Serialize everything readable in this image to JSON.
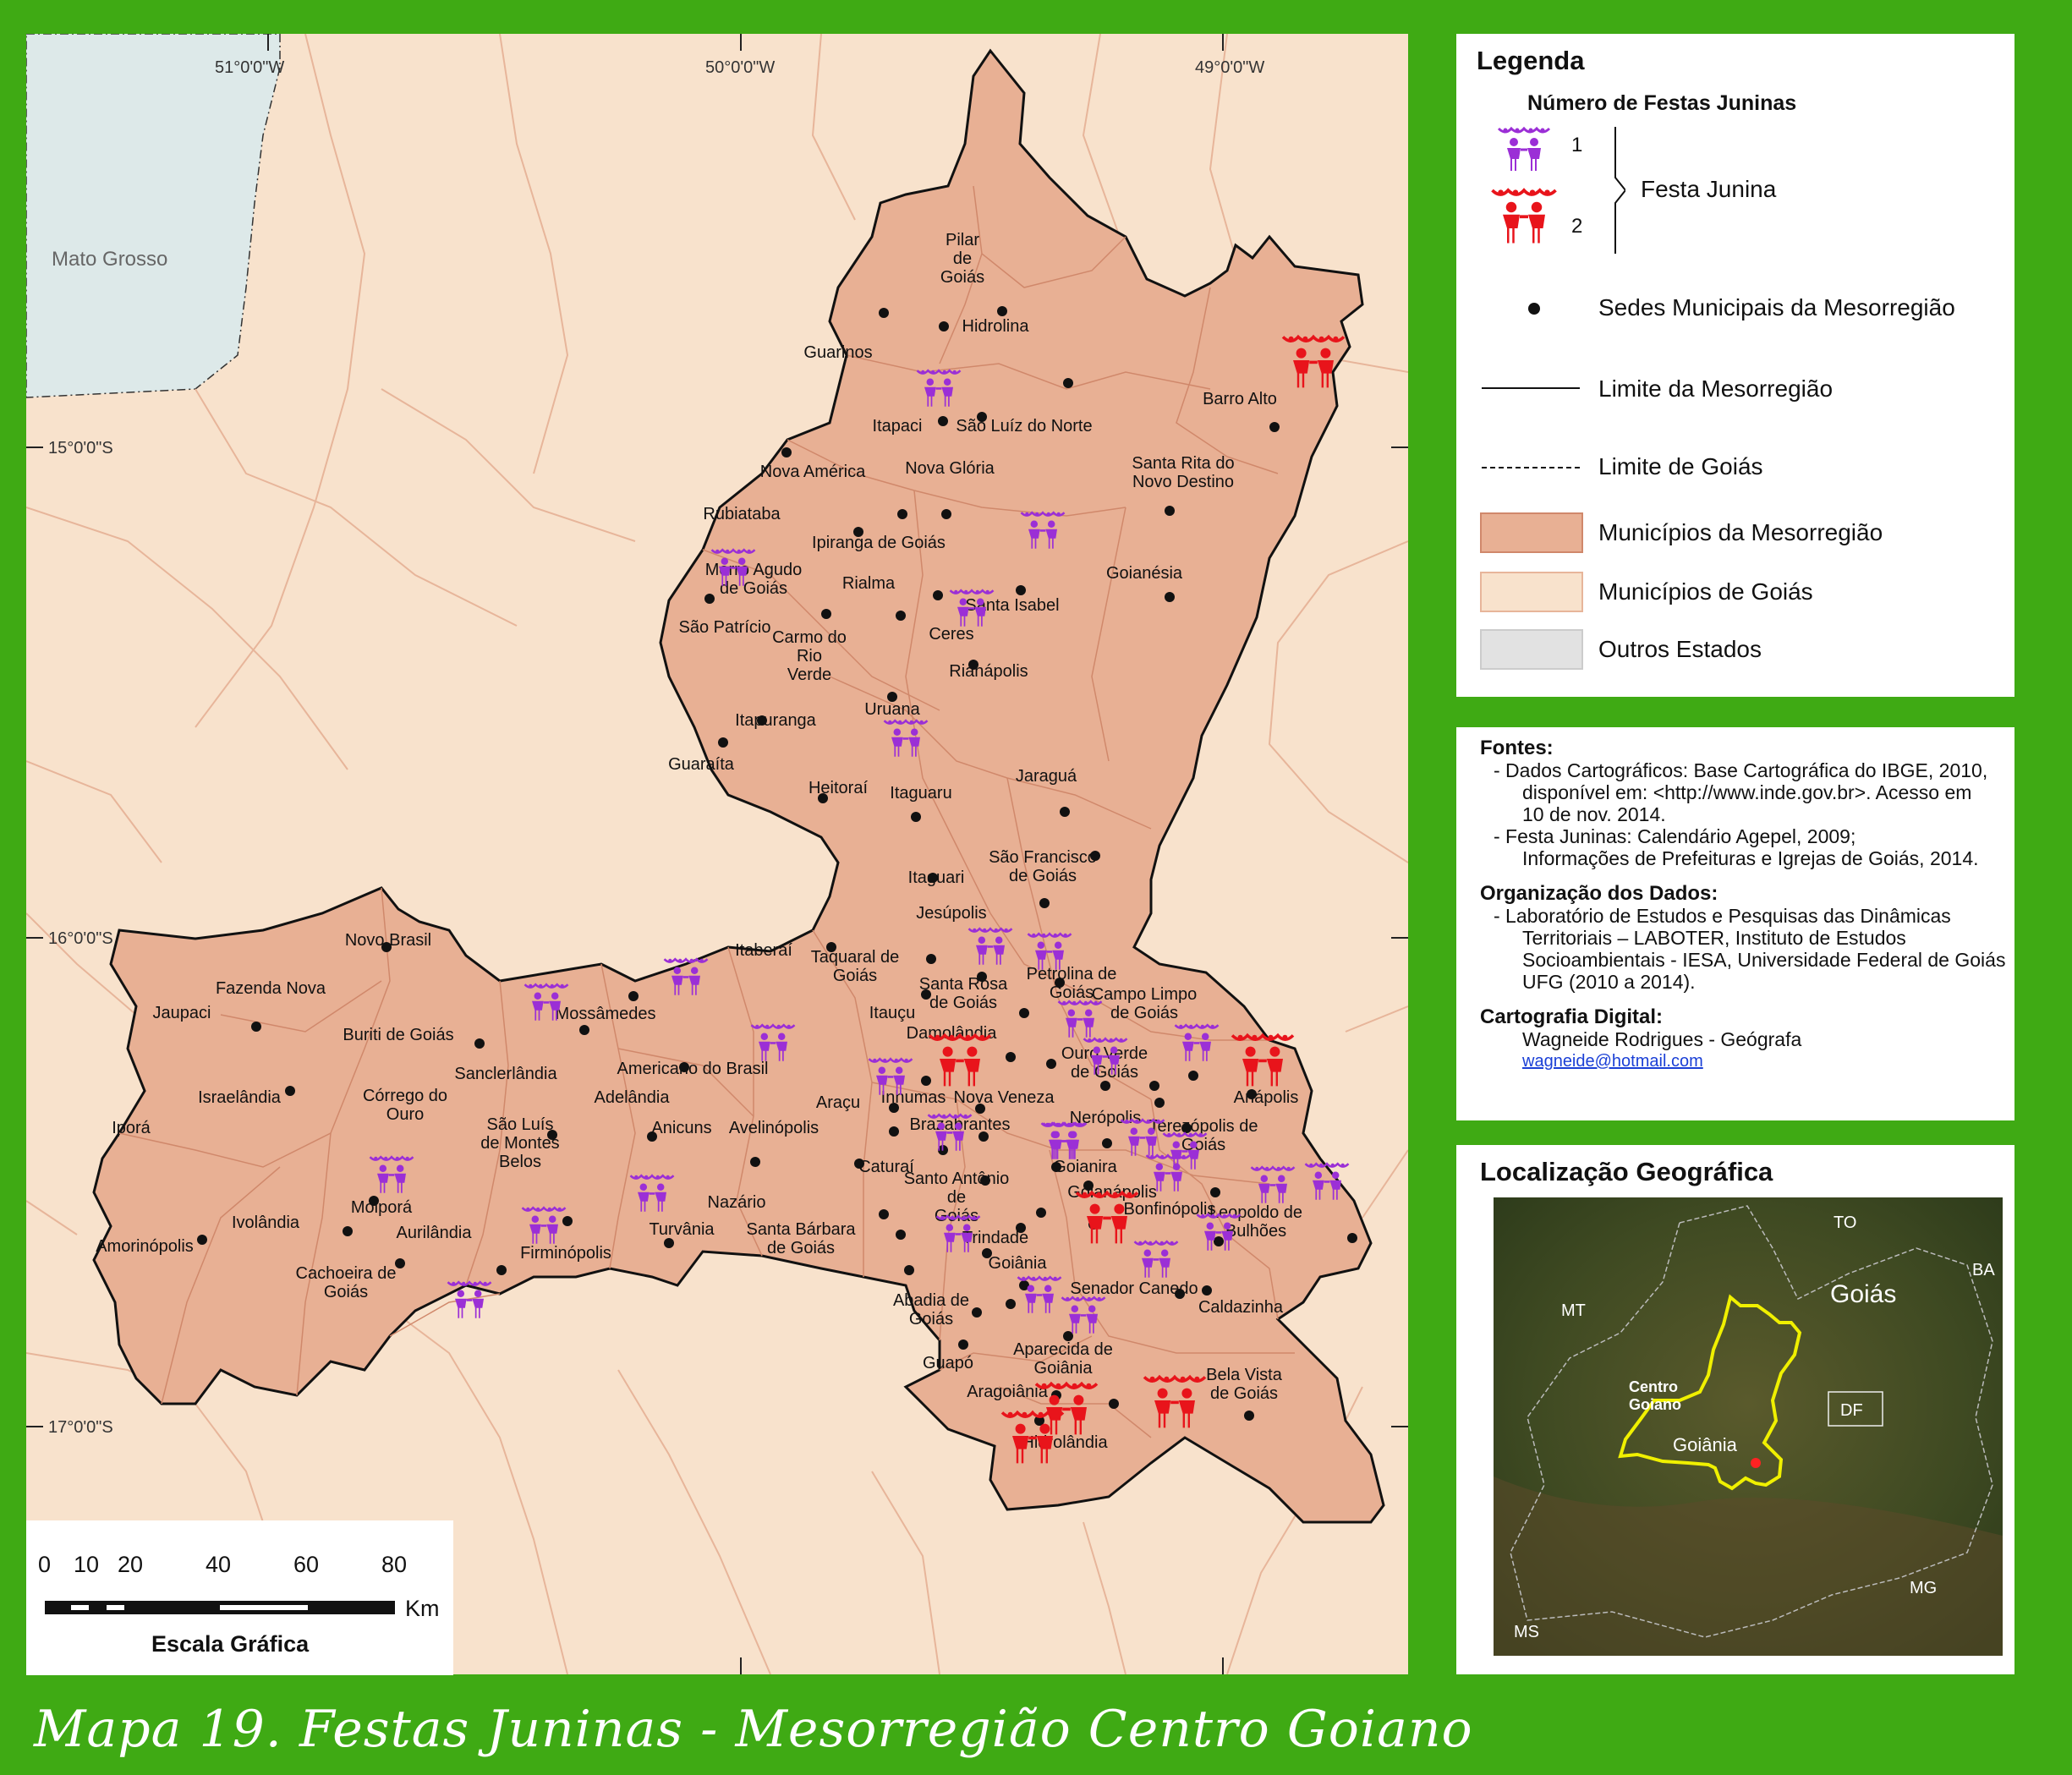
{
  "title": "Mapa 19. Festas Juninas - Mesorregião Centro Goiano",
  "map": {
    "coords": {
      "lon51": "51°0'0\"W",
      "lon50": "50°0'0\"W",
      "lon49": "49°0'0\"W",
      "lat15": "15°0'0\"S",
      "lat16": "16°0'0\"S",
      "lat17": "17°0'0\"S"
    },
    "neighbor_state": "Mato Grosso",
    "cities": [
      "Pilar de Goiás",
      "Hidrolina",
      "Guarinos",
      "Barro Alto",
      "Itapaci",
      "São Luíz do Norte",
      "Nova América",
      "Nova Glória",
      "Santa Rita do Novo Destino",
      "Rubiataba",
      "Ipiranga de Goiás",
      "Morro Agudo de Goiás",
      "Rialma",
      "Goianésia",
      "São Patrício",
      "Santa Isabel",
      "Carmo do Rio Verde",
      "Ceres",
      "Rianápolis",
      "Uruana",
      "Itapuranga",
      "Guaraíta",
      "Jaraguá",
      "Heitoraí",
      "Itaguaru",
      "São Francisco de Goiás",
      "Itaguari",
      "Jesúpolis",
      "Novo Brasil",
      "Itaberaí",
      "Taquaral de Goiás",
      "Fazenda Nova",
      "Santa Rosa de Goiás",
      "Petrolina de Goiás",
      "Campo Limpo de Goiás",
      "Jaupaci",
      "Mossâmedes",
      "Itauçu",
      "Buriti de Goiás",
      "Damolândia",
      "Ouro Verde de Goiás",
      "Sanclerlândia",
      "Americano do Brasil",
      "Anápolis",
      "Israelândia",
      "Córrego do Ouro",
      "Adelândia",
      "Inhumas",
      "Nova Veneza",
      "Araçu",
      "Nerópolis",
      "Iporá",
      "São Luís de Montes Belos",
      "Anicuns",
      "Avelinópolis",
      "Brazabrantes",
      "Terezópolis de Goiás",
      "Caturaí",
      "Goianira",
      "Moiporá",
      "Santo Antônio de Goiás",
      "Goianápolis",
      "Bonfinópolis",
      "Nazário",
      "Ivolândia",
      "Aurilândia",
      "Turvânia",
      "Leopoldo de Bulhões",
      "Amorinópolis",
      "Santa Bárbara de Goiás",
      "Trindade",
      "Firminópolis",
      "Goiânia",
      "Cachoeira de Goiás",
      "Senador Canedo",
      "Abadia de Goiás",
      "Caldazinha",
      "Aparecida de Goiânia",
      "Guapó",
      "Bela Vista de Goiás",
      "Aragoiânia",
      "Hidrolândia"
    ],
    "festas": {
      "one_count_color": "#9b2fd6",
      "two_count_color": "#e8141b"
    }
  },
  "legend": {
    "title": "Legenda",
    "subtitle": "Número de Festas Juninas",
    "count_one": "1",
    "count_two": "2",
    "festa_label": "Festa Junina",
    "sedes_label": "Sedes Municipais da Mesorregião",
    "limite_meso_label": "Limite da Mesorregião",
    "limite_goias_label": "Limite de Goiás",
    "municipios_meso_label": "Municípios da Mesorregião",
    "municipios_goias_label": "Municípios de Goiás",
    "outros_label": "Outros Estados",
    "colors": {
      "meso": "#e8b094",
      "goias": "#f8e2cc",
      "outros": "#e2e2e2"
    }
  },
  "sources": {
    "fontes_title": "Fontes:",
    "fontes_1a": "- Dados Cartográficos: Base Cartográfica do IBGE, 2010,",
    "fontes_1b": "disponível em: <http://www.inde.gov.br>.  Acesso em",
    "fontes_1c": "10 de nov. 2014.",
    "fontes_2a": "- Festa Juninas: Calendário Agepel, 2009;",
    "fontes_2b": "Informações de Prefeituras e Igrejas de Goiás, 2014.",
    "org_title": "Organização dos Dados:",
    "org_1": "- Laboratório de Estudos e Pesquisas das  Dinâmicas",
    "org_2": "Territoriais – LABOTER, Instituto de Estudos",
    "org_3": "Socioambientais - IESA, Universidade Federal de Goiás",
    "org_4": "UFG (2010 a 2014).",
    "carto_title": "Cartografia Digital:",
    "carto_name": "Wagneide Rodrigues - Geógrafa",
    "carto_email": "wagneide@hotmail.com"
  },
  "location": {
    "title": "Localização Geográfica",
    "labels": {
      "to": "TO",
      "ba": "BA",
      "mt": "MT",
      "goias": "Goiás",
      "centro": "Centro",
      "goiano": "Goiano",
      "df": "DF",
      "goiania": "Goiânia",
      "mg": "MG",
      "ms": "MS"
    }
  },
  "scale": {
    "ticks": [
      "0",
      "10",
      "20",
      "40",
      "60",
      "80"
    ],
    "unit": "Km",
    "title": "Escala Gráfica"
  }
}
